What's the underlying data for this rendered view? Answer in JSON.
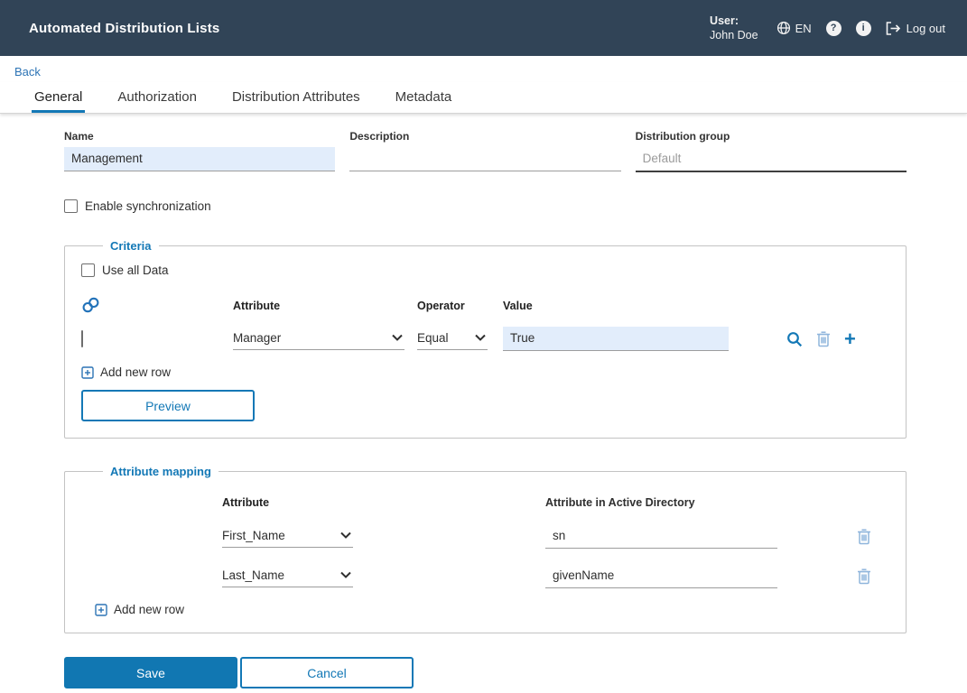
{
  "header": {
    "title": "Automated Distribution Lists",
    "user_label": "User:",
    "user_name": "John Doe",
    "language": "EN",
    "help_glyph": "?",
    "info_glyph": "i",
    "logout_label": "Log out"
  },
  "nav": {
    "back_label": "Back",
    "tabs": [
      {
        "label": "General",
        "active": true
      },
      {
        "label": "Authorization",
        "active": false
      },
      {
        "label": "Distribution Attributes",
        "active": false
      },
      {
        "label": "Metadata",
        "active": false
      }
    ]
  },
  "form": {
    "name": {
      "label": "Name",
      "value": "Management"
    },
    "description": {
      "label": "Description",
      "value": ""
    },
    "distribution_group": {
      "label": "Distribution group",
      "placeholder": "Default"
    },
    "enable_sync_label": "Enable synchronization"
  },
  "criteria": {
    "legend": "Criteria",
    "use_all_data_label": "Use all Data",
    "columns": {
      "attribute": "Attribute",
      "operator": "Operator",
      "value": "Value"
    },
    "rows": [
      {
        "attribute": "Manager",
        "operator": "Equal",
        "value": "True"
      }
    ],
    "add_row_label": "Add new row",
    "preview_label": "Preview"
  },
  "attribute_mapping": {
    "legend": "Attribute mapping",
    "columns": {
      "attribute": "Attribute",
      "ad_attribute": "Attribute in Active Directory"
    },
    "rows": [
      {
        "attribute": "First_Name",
        "ad_attribute": "sn"
      },
      {
        "attribute": "Last_Name",
        "ad_attribute": "givenName"
      }
    ],
    "add_row_label": "Add new row"
  },
  "actions": {
    "save_label": "Save",
    "cancel_label": "Cancel"
  },
  "colors": {
    "header_bg": "#314457",
    "primary": "#1378b6",
    "link": "#2d74b5",
    "field_highlight": "#e2edfb",
    "icon_light_blue": "#8fb5dc"
  }
}
